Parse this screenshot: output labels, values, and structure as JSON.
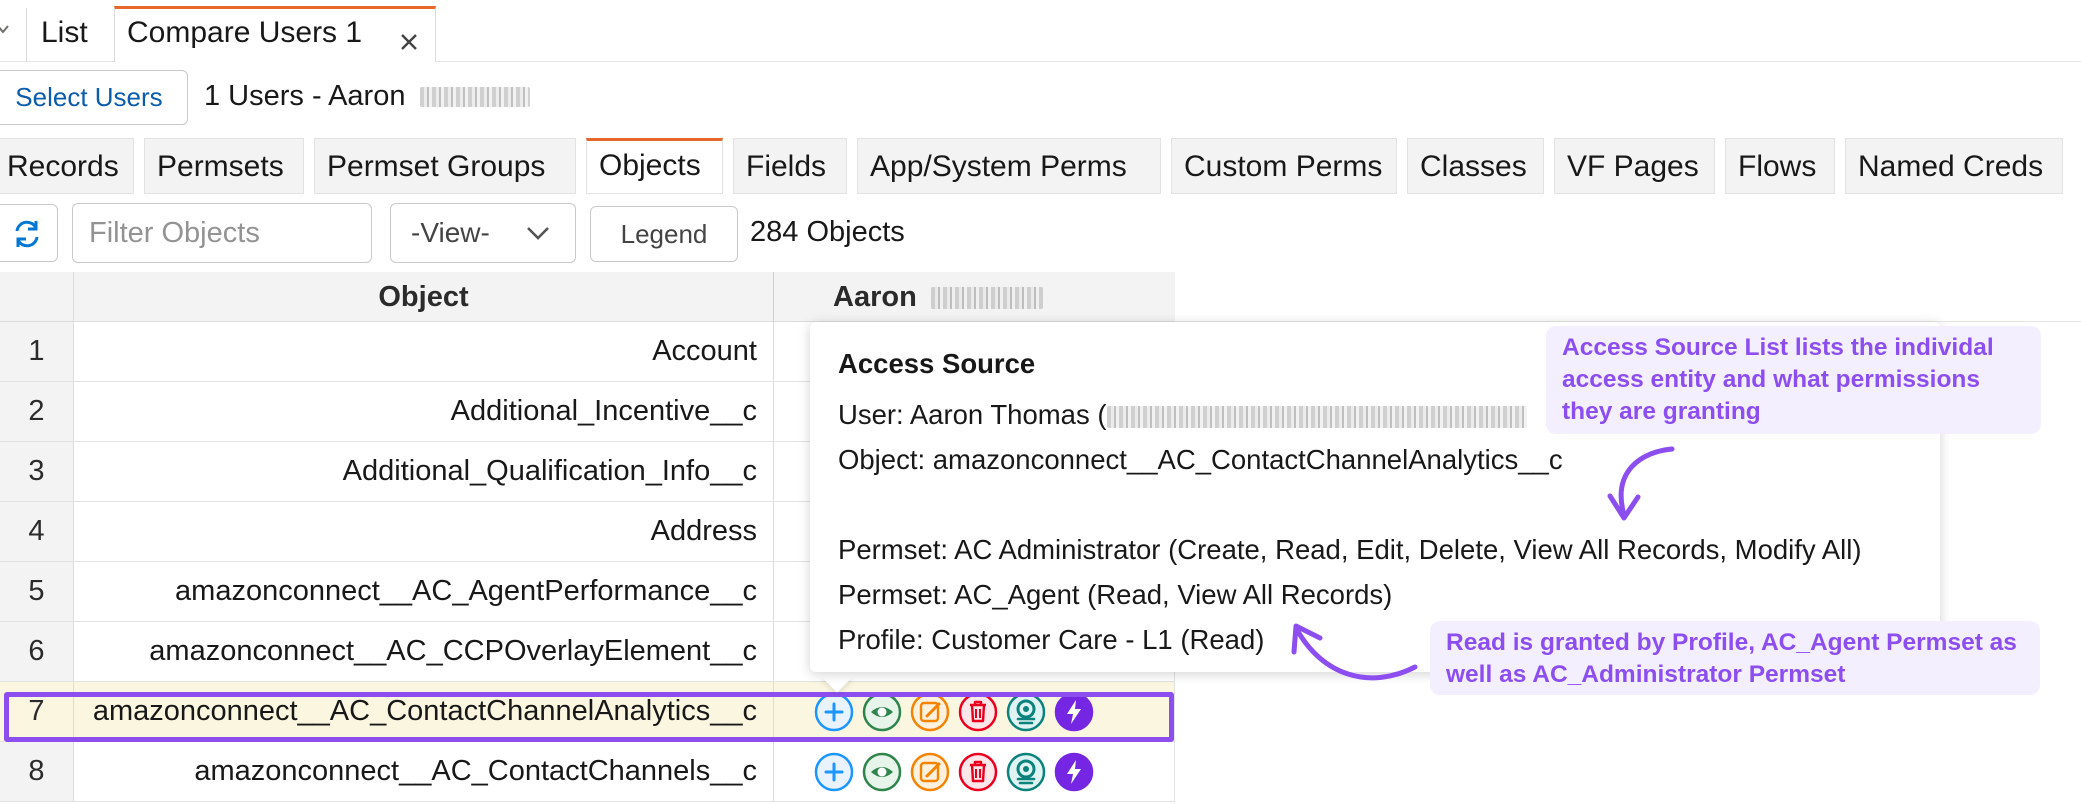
{
  "tabs": {
    "list_label": "List",
    "compare_label": "Compare Users 1"
  },
  "toolbar": {
    "select_users_label": "Select Users",
    "users_prefix": "1 Users - Aaron",
    "filter_placeholder": "Filter Objects",
    "view_label": "-View-",
    "legend_label": "Legend",
    "object_count": "284 Objects"
  },
  "subtabs": [
    {
      "label": "Records"
    },
    {
      "label": "Permsets"
    },
    {
      "label": "Permset Groups"
    },
    {
      "label": "Objects",
      "active": true
    },
    {
      "label": "Fields"
    },
    {
      "label": "App/System Perms"
    },
    {
      "label": "Custom Perms"
    },
    {
      "label": "Classes"
    },
    {
      "label": "VF Pages"
    },
    {
      "label": "Flows"
    },
    {
      "label": "Named Creds"
    }
  ],
  "grid": {
    "column_object": "Object",
    "column_user": "Aaron",
    "rows": [
      {
        "num": "1",
        "object": "Account"
      },
      {
        "num": "2",
        "object": "Additional_Incentive__c"
      },
      {
        "num": "3",
        "object": "Additional_Qualification_Info__c"
      },
      {
        "num": "4",
        "object": "Address"
      },
      {
        "num": "5",
        "object": "amazonconnect__AC_AgentPerformance__c"
      },
      {
        "num": "6",
        "object": "amazonconnect__AC_CCPOverlayElement__c"
      },
      {
        "num": "7",
        "object": "amazonconnect__AC_ContactChannelAnalytics__c"
      },
      {
        "num": "8",
        "object": "amazonconnect__AC_ContactChannels__c"
      }
    ]
  },
  "perm_icons": [
    {
      "name": "create-icon",
      "color": "#1b96ff",
      "fill": "#e8f3ff"
    },
    {
      "name": "read-icon",
      "color": "#2e844a",
      "fill": "#e6f4ea"
    },
    {
      "name": "edit-icon",
      "color": "#f38303",
      "fill": "#fff1dd"
    },
    {
      "name": "delete-icon",
      "color": "#ea001e",
      "fill": "#fde7e9"
    },
    {
      "name": "view-all-icon",
      "color": "#0b827c",
      "fill": "#dff3f2"
    },
    {
      "name": "modify-all-icon",
      "color": "#7526e3",
      "fill": "#7526e3"
    }
  ],
  "popover": {
    "title": "Access Source",
    "user_line": "User: Aaron Thomas (",
    "object_line": "Object: amazonconnect__AC_ContactChannelAnalytics__c",
    "lines": [
      "Permset: AC Administrator (Create, Read, Edit, Delete, View All Records, Modify All)",
      "Permset: AC_Agent (Read, View All Records)",
      "Profile: Customer Care - L1 (Read)"
    ]
  },
  "callouts": {
    "access_source": "Access Source List lists the individal access entity and what permissions they are granting",
    "read_granted": "Read is granted by Profile, AC_Agent Permset as well as AC_Administrator Permset"
  },
  "colors": {
    "accent_tab": "#e5682a",
    "link": "#0b5cab",
    "highlight_frame": "#8d4ef0",
    "callout_text": "#8d4ef0",
    "callout_bg": "#f4efff",
    "row_highlight": "#fbf6e0"
  }
}
